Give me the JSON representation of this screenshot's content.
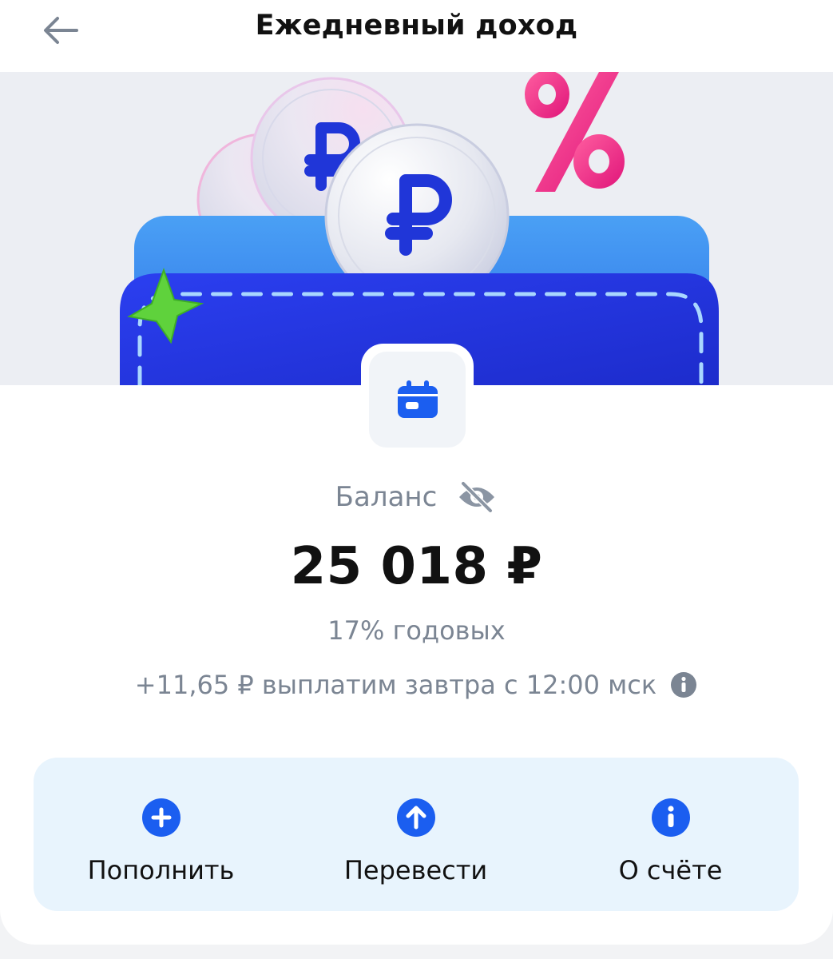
{
  "header": {
    "title": "Ежедневный доход",
    "back_icon": "arrow-left-icon"
  },
  "hero": {
    "illustration": "wallet-with-ruble-coins-illustration",
    "colors": {
      "wallet": "#2233e0",
      "percent": "#f0287a",
      "star": "#5fd23c",
      "coin": "#e9ebf2"
    }
  },
  "balance": {
    "label": "Баланс",
    "hide_icon": "eye-off-icon",
    "amount": "25 018 ₽",
    "rate": "17% годовых",
    "payout_note": "+11,65 ₽ выплатим завтра с 12:00 мск",
    "info_icon": "info-icon",
    "account_icon": "calendar-icon"
  },
  "actions": [
    {
      "label": "Пополнить",
      "icon": "plus-circle-icon"
    },
    {
      "label": "Перевести",
      "icon": "arrow-up-circle-icon"
    },
    {
      "label": "О счёте",
      "icon": "info-circle-icon"
    }
  ],
  "colors": {
    "accent": "#1b5ef0",
    "muted_text": "#7b8593",
    "text": "#111111",
    "actions_bg": "#e8f4fd"
  }
}
